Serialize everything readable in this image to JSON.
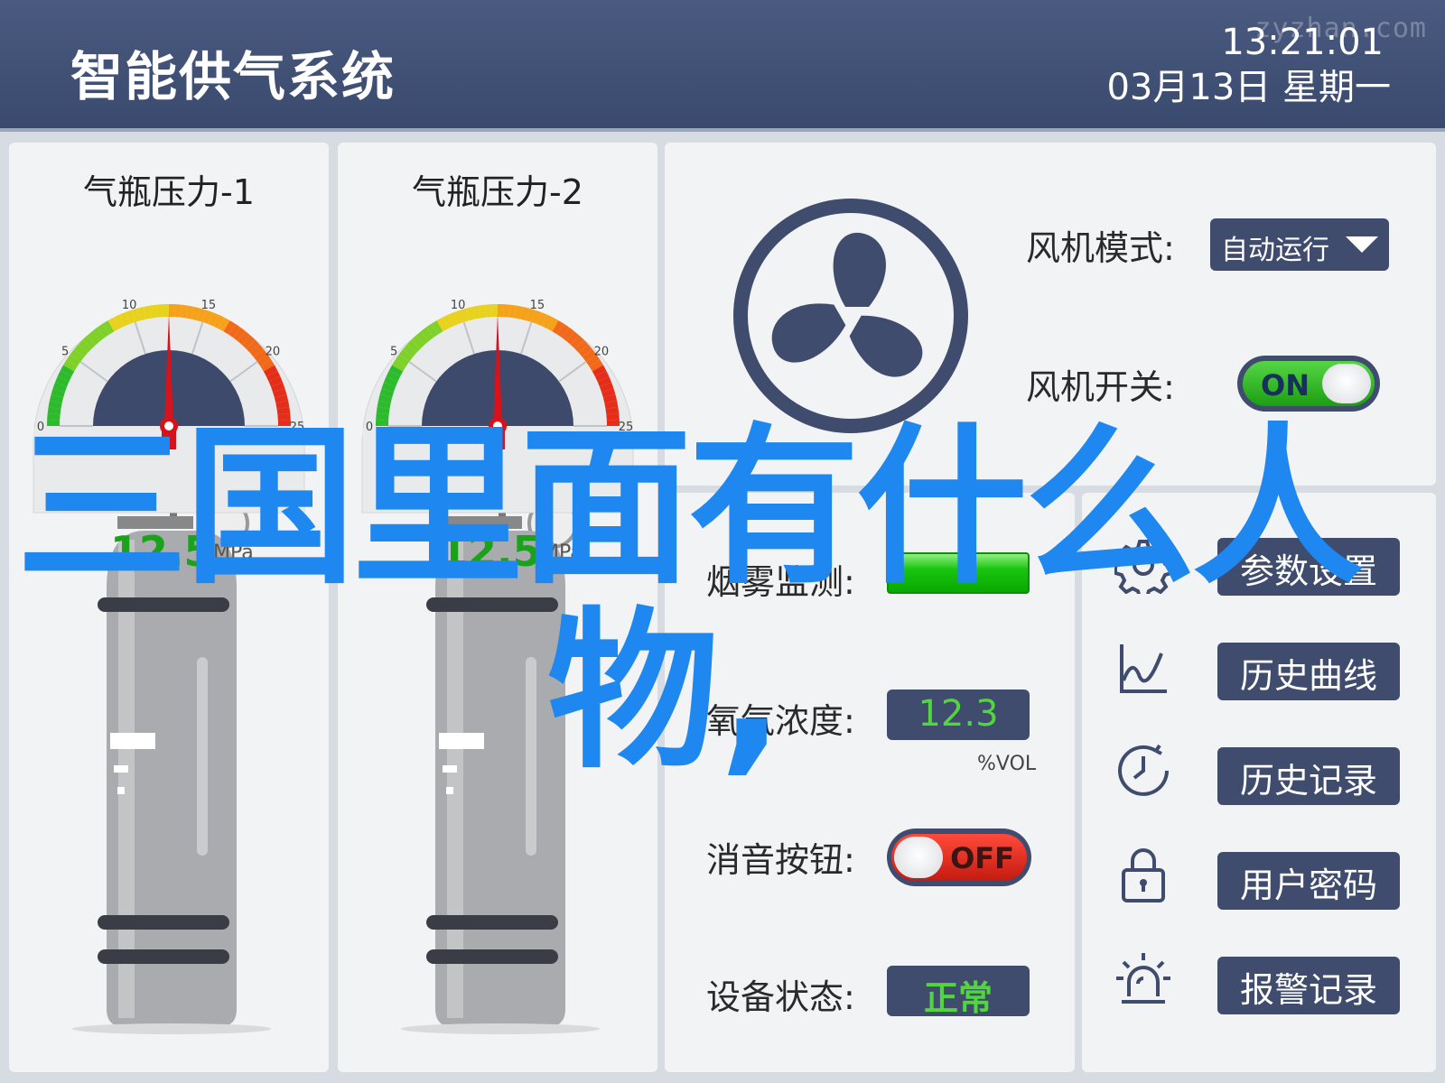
{
  "header": {
    "title": "智能供气系统",
    "time": "13:21:01",
    "date": "03月13日  星期一",
    "watermark": "zyzhan.com"
  },
  "cylinders": [
    {
      "title": "气瓶压力-1",
      "value": "12.5",
      "unit": "MPa",
      "ticks": [
        "0",
        "5",
        "10",
        "15",
        "20",
        "25"
      ],
      "pressure": 12.5
    },
    {
      "title": "气瓶压力-2",
      "value": "12.5",
      "unit": "MPa",
      "ticks": [
        "0",
        "5",
        "10",
        "15",
        "20",
        "25"
      ],
      "pressure": 12.5
    }
  ],
  "fan": {
    "mode_label": "风机模式:",
    "mode_value": "自动运行",
    "switch_label": "风机开关:",
    "switch_state": "ON"
  },
  "sensors": {
    "smoke_label": "烟雾监测:",
    "oxygen_label": "氧气浓度:",
    "oxygen_value": "12.3",
    "oxygen_unit": "%VOL",
    "mute_label": "消音按钮:",
    "mute_state": "OFF",
    "device_label": "设备状态:",
    "device_value": "正常"
  },
  "menu": [
    {
      "label": "参数设置",
      "icon": "gear-icon"
    },
    {
      "label": "历史曲线",
      "icon": "line-chart-icon"
    },
    {
      "label": "历史记录",
      "icon": "clock-icon"
    },
    {
      "label": "用户密码",
      "icon": "lock-icon"
    },
    {
      "label": "报警记录",
      "icon": "alarm-light-icon"
    }
  ],
  "overlay": {
    "line1": "三国里面有什么人",
    "line2": "物,"
  },
  "colors": {
    "header": "#3f4c6e",
    "accent_green": "#52d63e",
    "overlay_blue": "#1e88f0"
  }
}
